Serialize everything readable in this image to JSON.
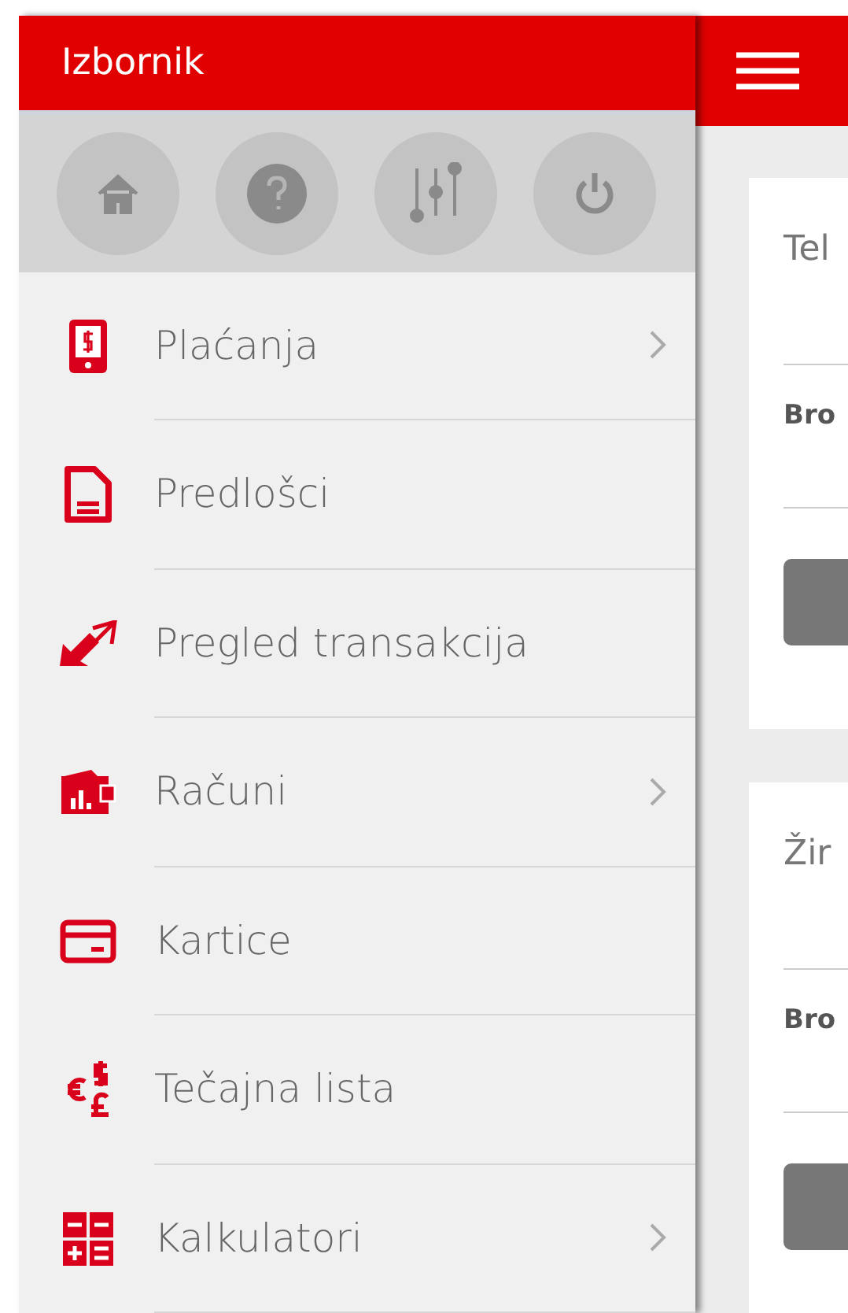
{
  "drawer": {
    "title": "Izbornik",
    "quick_actions": [
      {
        "kind": "home"
      },
      {
        "kind": "help"
      },
      {
        "kind": "settings"
      },
      {
        "kind": "power"
      }
    ],
    "items": [
      {
        "label": "Plaćanja",
        "kind": "payments",
        "has_submenu": true
      },
      {
        "label": "Predlošci",
        "kind": "templates",
        "has_submenu": false
      },
      {
        "label": "Pregled transakcija",
        "kind": "transactions",
        "has_submenu": false
      },
      {
        "label": "Računi",
        "kind": "accounts",
        "has_submenu": true
      },
      {
        "label": "Kartice",
        "kind": "cards",
        "has_submenu": false
      },
      {
        "label": "Tečajna lista",
        "kind": "rates",
        "has_submenu": false
      },
      {
        "label": "Kalkulatori",
        "kind": "calculators",
        "has_submenu": true
      }
    ]
  },
  "main": {
    "cards": [
      {
        "title": "Tel",
        "field_label": "Bro"
      },
      {
        "title": "Žir",
        "field_label": "Bro"
      }
    ]
  }
}
